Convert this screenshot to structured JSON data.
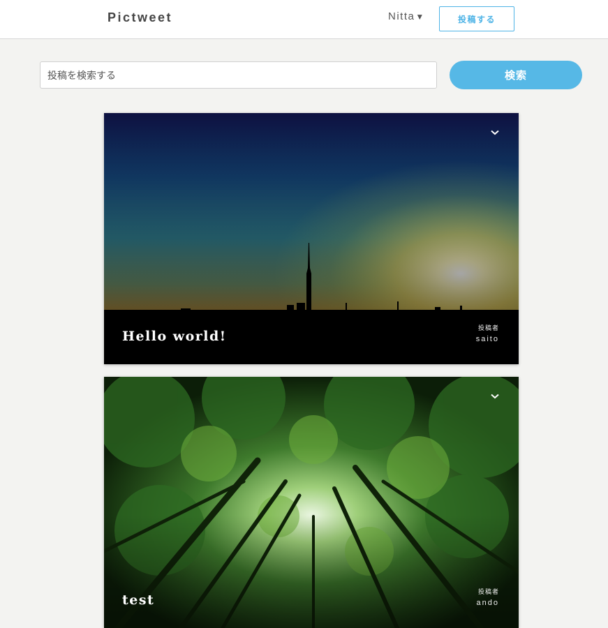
{
  "header": {
    "logo": "Pictweet",
    "user_name": "Nitta",
    "user_caret": "▼",
    "post_button": "投稿する"
  },
  "search": {
    "placeholder": "投稿を検索する",
    "value": "",
    "button_label": "検索"
  },
  "posts": [
    {
      "title": "Hello world!",
      "author_label": "投稿者",
      "author": "saito",
      "menu_icon": "chevron-down-icon"
    },
    {
      "title": "test",
      "author_label": "投稿者",
      "author": "ando",
      "menu_icon": "chevron-down-icon"
    }
  ],
  "colors": {
    "accent": "#56b8e6",
    "background": "#f3f3f1"
  }
}
